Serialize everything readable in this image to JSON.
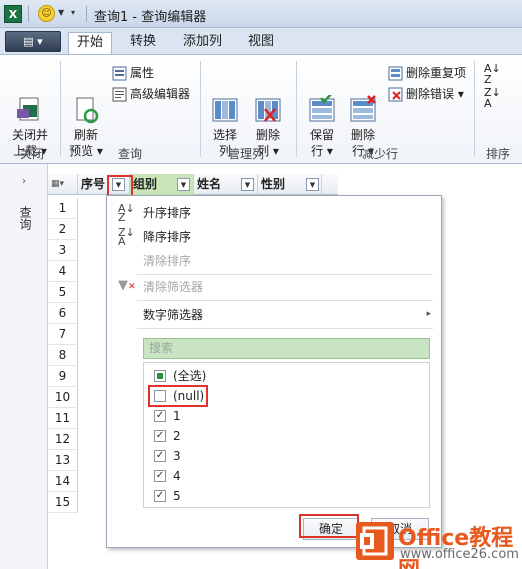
{
  "titlebar": {
    "title": "查询1 - 查询编辑器",
    "app_icon": "excel-icon"
  },
  "ribbon_tabs": {
    "file": "▤ ▾",
    "tabs": [
      "开始",
      "转换",
      "添加列",
      "视图"
    ]
  },
  "ribbon": {
    "close_load": "关闭并\n上载 ▾",
    "refresh": "刷新\n预览 ▾",
    "properties": "属性",
    "advanced_editor": "高级编辑器",
    "choose_columns": "选择\n列",
    "remove_columns": "删除\n列 ▾",
    "keep_rows": "保留\n行 ▾",
    "remove_rows": "删除\n行 ▾",
    "remove_duplicates": "删除重复项",
    "remove_errors": "删除错误 ▾",
    "groups": {
      "close": "关闭",
      "query": "查询",
      "manage_columns": "管理列",
      "reduce_rows": "减少行",
      "sort": "排序"
    }
  },
  "left_pane": {
    "label": "查询"
  },
  "grid": {
    "headers": [
      "序号",
      "组别",
      "姓名",
      "性别"
    ],
    "rows": [
      "1",
      "2",
      "3",
      "4",
      "5",
      "6",
      "7",
      "8",
      "9",
      "10",
      "11",
      "12",
      "13",
      "14",
      "15"
    ]
  },
  "dropdown": {
    "sort_asc": "升序排序",
    "sort_desc": "降序排序",
    "clear_sort": "清除排序",
    "clear_filter": "清除筛选器",
    "number_filters": "数字筛选器",
    "search_placeholder": "搜索",
    "items": [
      "(全选)",
      "(null)",
      "1",
      "2",
      "3",
      "4",
      "5"
    ],
    "ok": "确定",
    "cancel": "取消"
  },
  "watermark": {
    "brand": "Office教程网",
    "url": "www.office26.com"
  },
  "colors": {
    "accent_red": "#e0332c",
    "selected_header": "#c9e5b9",
    "watermark": "#e8591e"
  }
}
